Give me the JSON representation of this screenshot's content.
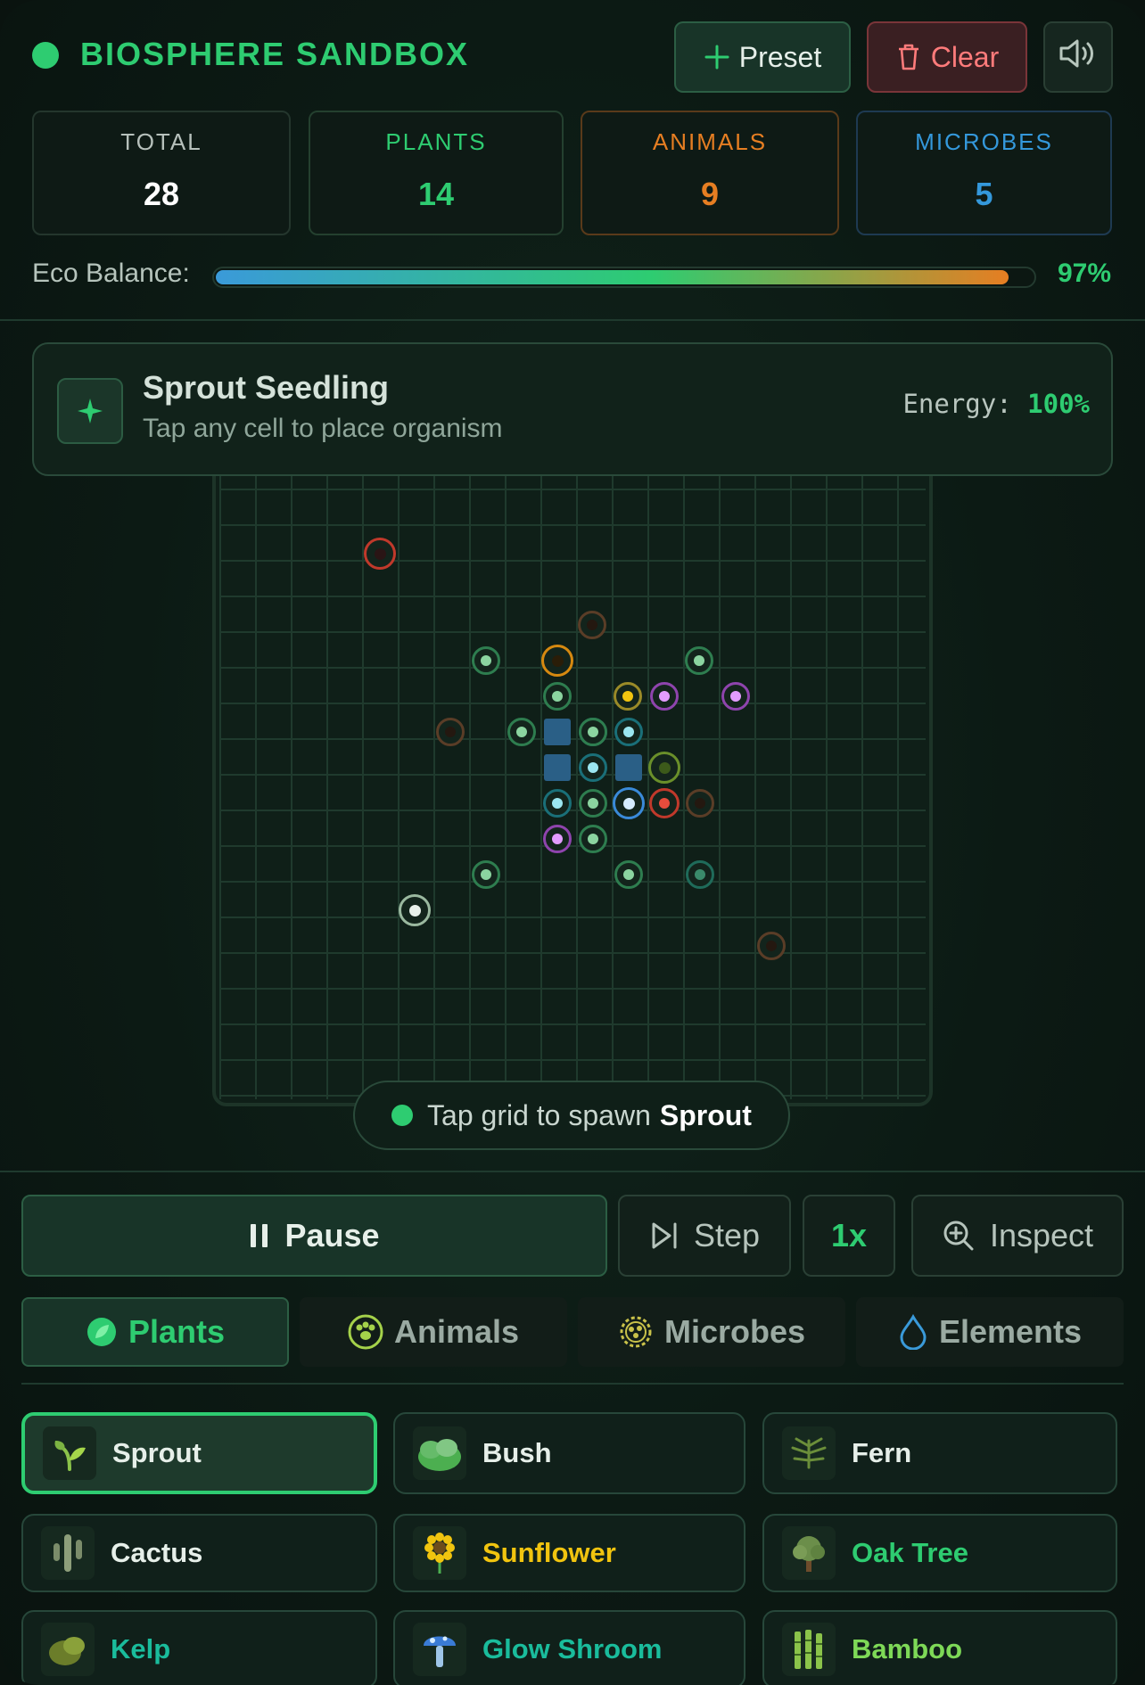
{
  "app": {
    "title": "BIOSPHERE SANDBOX"
  },
  "header_buttons": {
    "preset": "Preset",
    "clear": "Clear"
  },
  "stats": [
    {
      "label": "TOTAL",
      "value": "28"
    },
    {
      "label": "PLANTS",
      "value": "14"
    },
    {
      "label": "ANIMALS",
      "value": "9"
    },
    {
      "label": "MICROBES",
      "value": "5"
    }
  ],
  "eco": {
    "label": "Eco Balance:",
    "value_text": "97%",
    "fraction": 0.97
  },
  "selected": {
    "title": "Sprout Seedling",
    "subtitle": "Tap any cell to place organism",
    "energy_label": "Energy:",
    "energy_value": "100%"
  },
  "grid_organisms": [
    {
      "kind": "animal-red",
      "icon": "rat"
    },
    {
      "kind": "animal-brown",
      "icon": "turtle"
    },
    {
      "kind": "plant",
      "icon": "sprout"
    },
    {
      "kind": "animal-orange",
      "icon": "bee"
    },
    {
      "kind": "plant",
      "icon": "sprout"
    },
    {
      "kind": "plant",
      "icon": "sprout"
    },
    {
      "kind": "plant-yellow",
      "icon": "sunflower"
    },
    {
      "kind": "microbe-purple",
      "icon": "spore"
    },
    {
      "kind": "microbe-purple",
      "icon": "mushroom"
    },
    {
      "kind": "animal-brown",
      "icon": "worm"
    },
    {
      "kind": "plant",
      "icon": "sprout"
    },
    {
      "kind": "microbe-cyan",
      "icon": "cell"
    },
    {
      "kind": "plant",
      "icon": "bush"
    },
    {
      "kind": "microbe-cyan",
      "icon": "cell"
    },
    {
      "kind": "microbe-cyan",
      "icon": "cell"
    },
    {
      "kind": "plant-lime",
      "icon": "cactus"
    },
    {
      "kind": "microbe-cyan",
      "icon": "cell"
    },
    {
      "kind": "plant",
      "icon": "oak"
    },
    {
      "kind": "microbe-blue",
      "icon": "cell"
    },
    {
      "kind": "animal-crimson",
      "icon": "beetle"
    },
    {
      "kind": "animal-brown",
      "icon": "deer"
    },
    {
      "kind": "microbe-purple",
      "icon": "spore"
    },
    {
      "kind": "plant",
      "icon": "sprout"
    },
    {
      "kind": "plant",
      "icon": "bush"
    },
    {
      "kind": "plant",
      "icon": "frog"
    },
    {
      "kind": "plant-teal",
      "icon": "reed"
    },
    {
      "kind": "plant-white",
      "icon": "seed"
    },
    {
      "kind": "animal-brown",
      "icon": "fox"
    }
  ],
  "hint": {
    "text": "Tap grid to spawn",
    "target": "Sprout"
  },
  "controls": {
    "pause": "Pause",
    "step": "Step",
    "speed": "1x",
    "inspect": "Inspect"
  },
  "tabs": [
    "Plants",
    "Animals",
    "Microbes",
    "Elements"
  ],
  "organisms": [
    {
      "name": "Sprout",
      "icon": "sprout",
      "color": "#e6efe9"
    },
    {
      "name": "Bush",
      "icon": "bush",
      "color": "#e6efe9"
    },
    {
      "name": "Fern",
      "icon": "fern",
      "color": "#e6efe9"
    },
    {
      "name": "Cactus",
      "icon": "cactus",
      "color": "#e6efe9"
    },
    {
      "name": "Sunflower",
      "icon": "sunflower",
      "color": "#f1c40f"
    },
    {
      "name": "Oak Tree",
      "icon": "oak-tree",
      "color": "#2ecc71"
    },
    {
      "name": "Kelp",
      "icon": "kelp",
      "color": "#1abc9c"
    },
    {
      "name": "Glow Shroom",
      "icon": "glow-shroom",
      "color": "#1abc9c"
    },
    {
      "name": "Bamboo",
      "icon": "bamboo",
      "color": "#7ed957"
    }
  ],
  "colors": {
    "accent": "#2ecc71",
    "animal": "#e67e22",
    "microbe": "#3498db",
    "danger": "#ff7b7b"
  }
}
